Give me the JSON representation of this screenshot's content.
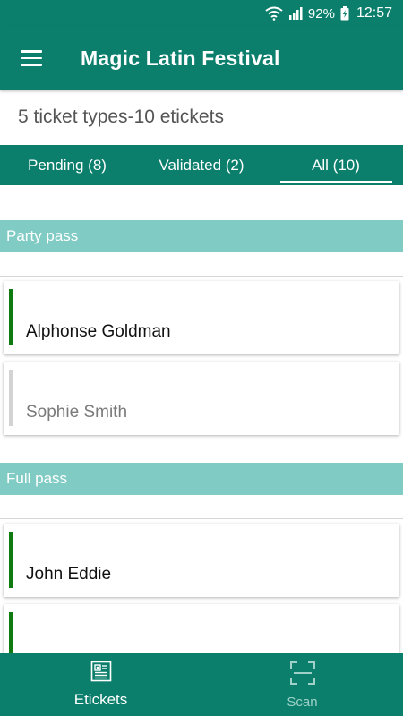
{
  "status_bar": {
    "battery": "92%",
    "time": "12:57"
  },
  "app_bar": {
    "title": "Magic Latin Festival",
    "menu_icon": "hamburger-menu-icon"
  },
  "summary": {
    "ticket_types": "5 ticket types",
    "separator": "-",
    "etickets": "10 etickets"
  },
  "tabs": [
    {
      "label": "Pending (8)",
      "active": false
    },
    {
      "label": "Validated (2)",
      "active": false
    },
    {
      "label": "All (10)",
      "active": true
    }
  ],
  "sections": [
    {
      "title": "Party pass",
      "tickets": [
        {
          "name": "Alphonse Goldman",
          "status": "validated"
        },
        {
          "name": "Sophie Smith",
          "status": "pending"
        }
      ]
    },
    {
      "title": "Full pass",
      "tickets": [
        {
          "name": "John Eddie",
          "status": "validated"
        },
        {
          "name": "",
          "status": "validated"
        }
      ]
    }
  ],
  "bottom_nav": [
    {
      "label": "Etickets",
      "icon": "etickets-icon",
      "active": true
    },
    {
      "label": "Scan",
      "icon": "scan-icon",
      "active": false
    }
  ],
  "colors": {
    "primary": "#0b7f6c",
    "section_header": "#80cbc4",
    "validated": "#0f7a10",
    "pending": "#d3d3d3"
  }
}
